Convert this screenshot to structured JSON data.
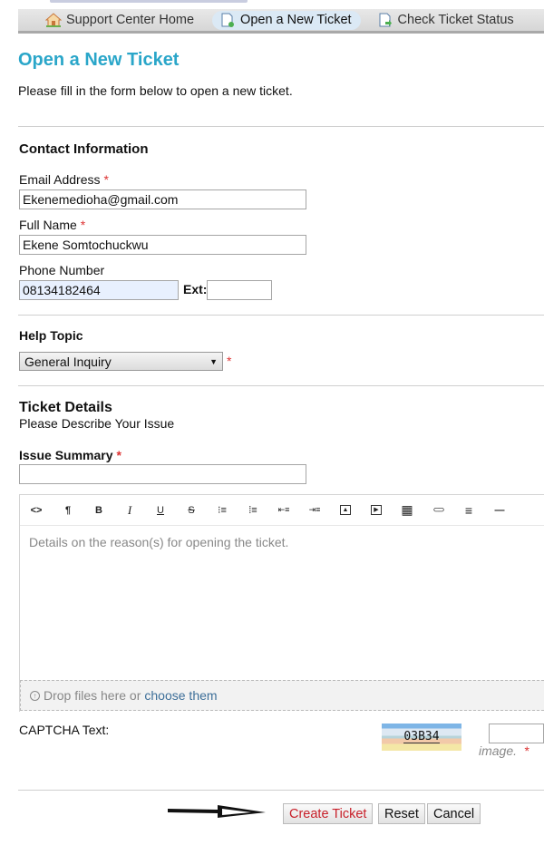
{
  "nav": {
    "items": [
      {
        "label": "Support Center Home",
        "icon": "home-icon",
        "active": false
      },
      {
        "label": "Open a New Ticket",
        "icon": "new-ticket-icon",
        "active": true
      },
      {
        "label": "Check Ticket Status",
        "icon": "ticket-status-icon",
        "active": false
      }
    ]
  },
  "page": {
    "title": "Open a New Ticket",
    "intro": "Please fill in the form below to open a new ticket."
  },
  "contact": {
    "title": "Contact Information",
    "email_label": "Email Address",
    "email_value": "Ekenemedioha@gmail.com",
    "name_label": "Full Name",
    "name_value": "Ekene Somtochuckwu",
    "phone_label": "Phone Number",
    "phone_value": "08134182464",
    "ext_label": "Ext:",
    "ext_value": "",
    "required_mark": "*"
  },
  "help_topic": {
    "title": "Help Topic",
    "selected": "General Inquiry",
    "arrow": "▼",
    "required_mark": "*"
  },
  "details": {
    "title": "Ticket Details",
    "subtitle": "Please Describe Your Issue",
    "summary_label": "Issue Summary",
    "summary_value": "",
    "required_mark": "*",
    "editor_placeholder": "Details on the reason(s) for opening the ticket.",
    "toolbar": [
      {
        "name": "html-icon",
        "glyph": "<>"
      },
      {
        "name": "paragraph-icon",
        "glyph": "¶"
      },
      {
        "name": "bold-icon",
        "glyph": "B"
      },
      {
        "name": "italic-icon",
        "glyph": "I"
      },
      {
        "name": "underline-icon",
        "glyph": "U"
      },
      {
        "name": "strikethrough-icon",
        "glyph": "S"
      },
      {
        "name": "unordered-list-icon",
        "glyph": "⁝≡"
      },
      {
        "name": "ordered-list-icon",
        "glyph": "⁞≡"
      },
      {
        "name": "outdent-icon",
        "glyph": "⇤≡"
      },
      {
        "name": "indent-icon",
        "glyph": "⇥≡"
      },
      {
        "name": "image-icon",
        "glyph": "▲"
      },
      {
        "name": "video-icon",
        "glyph": "▶"
      },
      {
        "name": "table-icon",
        "glyph": "▦"
      },
      {
        "name": "link-icon",
        "glyph": "⊂⊃"
      },
      {
        "name": "align-icon",
        "glyph": "≡"
      },
      {
        "name": "horizontal-rule-icon",
        "glyph": "—"
      }
    ],
    "dropzone_text": "Drop files here or",
    "dropzone_link": "choose them"
  },
  "captcha": {
    "label": "CAPTCHA Text:",
    "code": "03B34",
    "value": "",
    "note": "image.",
    "required_mark": "*"
  },
  "actions": {
    "create": "Create Ticket",
    "reset": "Reset",
    "cancel": "Cancel"
  }
}
